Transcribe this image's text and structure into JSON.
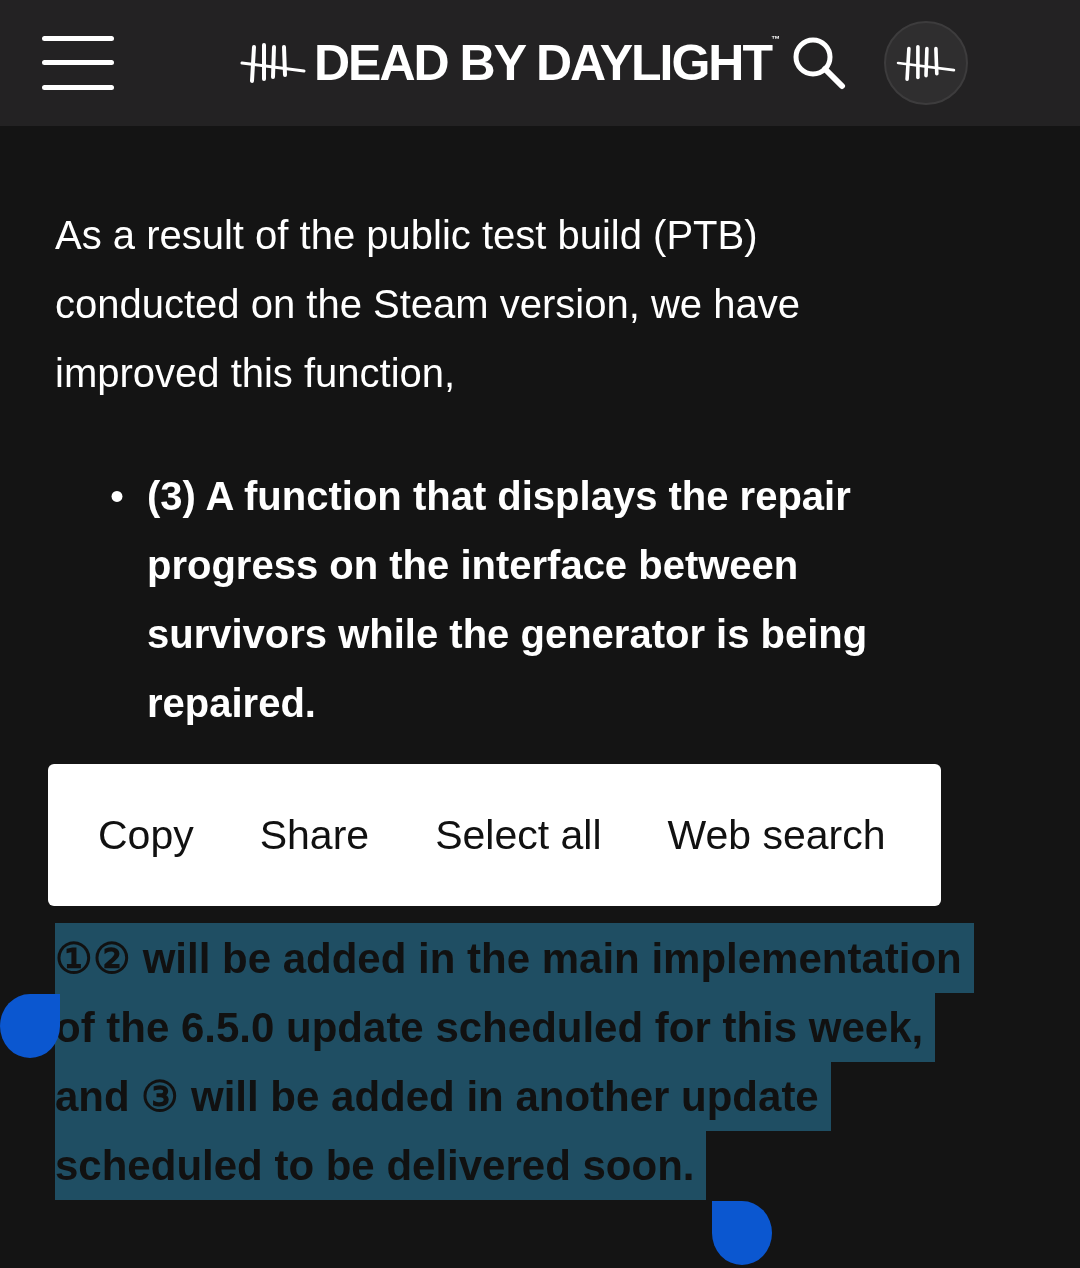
{
  "header": {
    "logo_text": "DEAD BY DAYLIGHT",
    "trademark": "™"
  },
  "article": {
    "intro": "As a result of the public test build (PTB) conducted on the Steam version, we have improved this function,",
    "bullet_marker": "•",
    "bullets": [
      "(3) A function that displays the repair progress on the interface between survivors while the generator is being repaired."
    ],
    "selected_paragraph": {
      "text": "①② will be added in the main implementation of the 6.5.0 update scheduled for this week, and ③ will be added in another update scheduled to be delivered soon.",
      "selected": true
    }
  },
  "context_menu": {
    "items": [
      "Copy",
      "Share",
      "Select all",
      "Web search"
    ]
  }
}
